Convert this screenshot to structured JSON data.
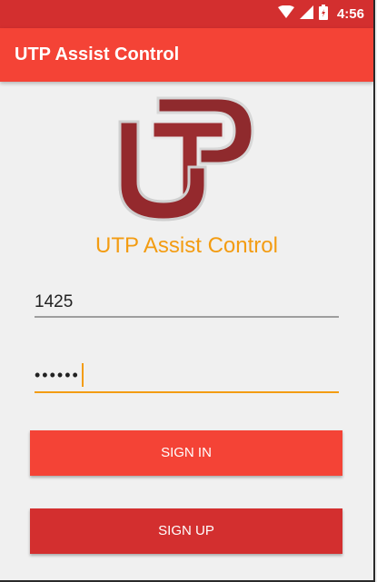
{
  "status_bar": {
    "time": "4:56",
    "icons": [
      "wifi-icon",
      "signal-icon",
      "battery-icon"
    ]
  },
  "app_bar": {
    "title": "UTP Assist Control"
  },
  "logo": {
    "caption": "UTP Assist Control"
  },
  "form": {
    "username_value": "1425",
    "password_masked": "••••••"
  },
  "buttons": {
    "sign_in": "SIGN IN",
    "sign_up": "SIGN UP"
  },
  "colors": {
    "status_bar": "#d32f2f",
    "app_bar": "#f44336",
    "accent": "#f39c12",
    "logo_red": "#9b2d30"
  }
}
